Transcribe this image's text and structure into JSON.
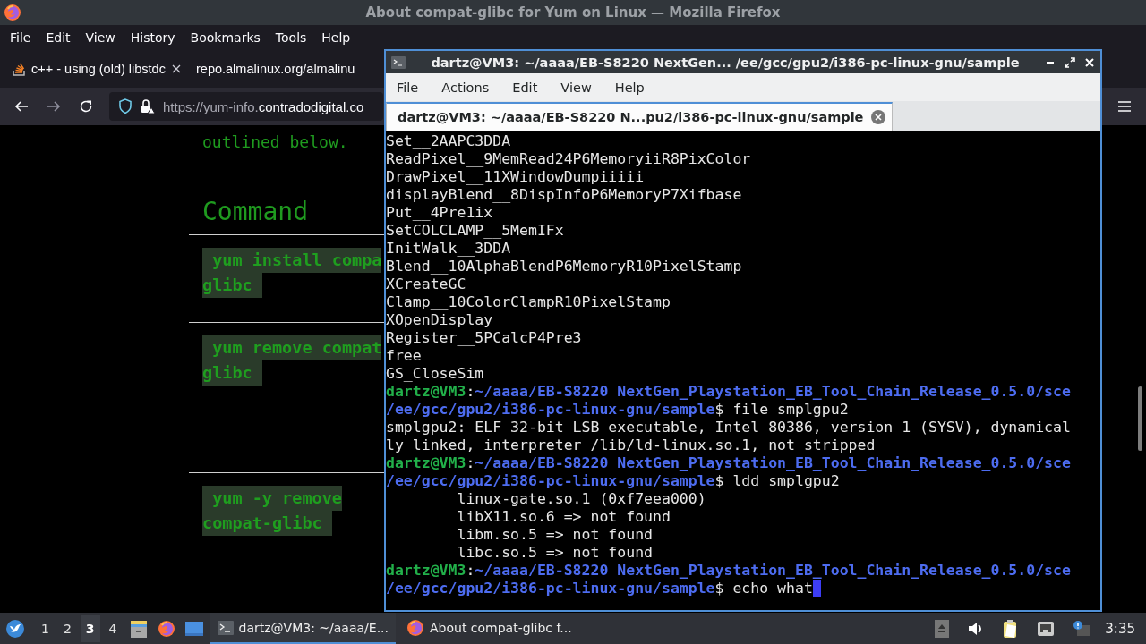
{
  "firefox": {
    "title": "About compat-glibc for Yum on Linux — Mozilla Firefox",
    "menu": [
      "File",
      "Edit",
      "View",
      "History",
      "Bookmarks",
      "Tools",
      "Help"
    ],
    "tabs": [
      {
        "label": "c++ - using (old) libstdc",
        "selected": false
      },
      {
        "label": "repo.almalinux.org/almalinu",
        "selected": false
      }
    ],
    "address": {
      "prefix": "https://yum-info.",
      "domain": "contradodigital.co"
    },
    "page": {
      "paragraph_end": "outlined below.",
      "heading": "Command",
      "code_blocks": [
        {
          "lines": [
            " yum install compa",
            "glibc "
          ]
        },
        {
          "lines": [
            " yum remove compat",
            "glibc "
          ]
        },
        {
          "lines": [
            " yum -y remove",
            "compat-glibc "
          ]
        }
      ]
    }
  },
  "terminal": {
    "title": "dartz@VM3: ~/aaaa/EB-S8220 NextGen... /ee/gcc/gpu2/i386-pc-linux-gnu/sample",
    "menu": [
      "File",
      "Actions",
      "Edit",
      "View",
      "Help"
    ],
    "tabs": [
      {
        "label": "dartz@VM3: ~/aaaa/EB-S8220 N...pu2/i386-pc-linux-gnu/sample",
        "selected": true
      }
    ],
    "lines": [
      [
        {
          "kind": "text",
          "text": "Set__2AAPC3DDA"
        }
      ],
      [
        {
          "kind": "text",
          "text": "ReadPixel__9MemRead24P6MemoryiiR8PixColor"
        }
      ],
      [
        {
          "kind": "text",
          "text": "DrawPixel__11XWindowDumpiiiii"
        }
      ],
      [
        {
          "kind": "text",
          "text": "displayBlend__8DispInfoP6MemoryP7Xifbase"
        }
      ],
      [
        {
          "kind": "text",
          "text": "Put__4Pre1ix"
        }
      ],
      [
        {
          "kind": "text",
          "text": "SetCOLCLAMP__5MemIFx"
        }
      ],
      [
        {
          "kind": "text",
          "text": "InitWalk__3DDA"
        }
      ],
      [
        {
          "kind": "text",
          "text": "Blend__10AlphaBlendP6MemoryR10PixelStamp"
        }
      ],
      [
        {
          "kind": "text",
          "text": "XCreateGC"
        }
      ],
      [
        {
          "kind": "text",
          "text": "Clamp__10ColorClampR10PixelStamp"
        }
      ],
      [
        {
          "kind": "text",
          "text": "XOpenDisplay"
        }
      ],
      [
        {
          "kind": "text",
          "text": "Register__5PCalcP4Pre3"
        }
      ],
      [
        {
          "kind": "text",
          "text": "free"
        }
      ],
      [
        {
          "kind": "text",
          "text": "GS_CloseSim"
        }
      ],
      [
        {
          "kind": "user",
          "text": "dartz@VM3"
        },
        {
          "kind": "text",
          "text": ":"
        },
        {
          "kind": "path",
          "text": "~/aaaa/EB-S8220 NextGen_Playstation_EB_Tool_Chain_Release_0.5.0/sce"
        }
      ],
      [
        {
          "kind": "path",
          "text": "/ee/gcc/gpu2/i386-pc-linux-gnu/sample"
        },
        {
          "kind": "text",
          "text": "$ file smplgpu2"
        }
      ],
      [
        {
          "kind": "text",
          "text": "smplgpu2: ELF 32-bit LSB executable, Intel 80386, version 1 (SYSV), dynamical"
        }
      ],
      [
        {
          "kind": "text",
          "text": "ly linked, interpreter /lib/ld-linux.so.1, not stripped"
        }
      ],
      [
        {
          "kind": "user",
          "text": "dartz@VM3"
        },
        {
          "kind": "text",
          "text": ":"
        },
        {
          "kind": "path",
          "text": "~/aaaa/EB-S8220 NextGen_Playstation_EB_Tool_Chain_Release_0.5.0/sce"
        }
      ],
      [
        {
          "kind": "path",
          "text": "/ee/gcc/gpu2/i386-pc-linux-gnu/sample"
        },
        {
          "kind": "text",
          "text": "$ ldd smplgpu2"
        }
      ],
      [
        {
          "kind": "text",
          "text": "        linux-gate.so.1 (0xf7eea000)"
        }
      ],
      [
        {
          "kind": "text",
          "text": "        libX11.so.6 => not found"
        }
      ],
      [
        {
          "kind": "text",
          "text": "        libm.so.5 => not found"
        }
      ],
      [
        {
          "kind": "text",
          "text": "        libc.so.5 => not found"
        }
      ],
      [
        {
          "kind": "user",
          "text": "dartz@VM3"
        },
        {
          "kind": "text",
          "text": ":"
        },
        {
          "kind": "path",
          "text": "~/aaaa/EB-S8220 NextGen_Playstation_EB_Tool_Chain_Release_0.5.0/sce"
        }
      ],
      [
        {
          "kind": "path",
          "text": "/ee/gcc/gpu2/i386-pc-linux-gnu/sample"
        },
        {
          "kind": "text",
          "text": "$ echo what"
        },
        {
          "kind": "cursor"
        }
      ]
    ]
  },
  "taskbar": {
    "workspaces": [
      {
        "label": "1",
        "selected": false
      },
      {
        "label": "2",
        "selected": false
      },
      {
        "label": "3",
        "selected": true
      },
      {
        "label": "4",
        "selected": false
      }
    ],
    "tasks": [
      {
        "kind": "terminal",
        "label": "dartz@VM3: ~/aaaa/E...",
        "selected": true
      },
      {
        "kind": "browser",
        "label": "About compat-glibc f...",
        "selected": false
      }
    ],
    "clock": "3:35"
  }
}
